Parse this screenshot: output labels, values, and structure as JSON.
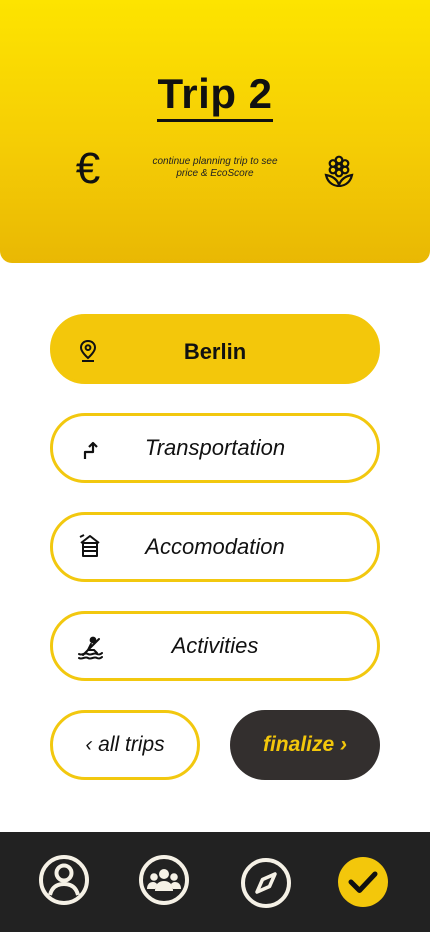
{
  "header": {
    "title": "Trip 2",
    "note": "continue planning trip to see price & EcoScore",
    "price_icon": "euro-icon",
    "eco_icon": "flower-icon"
  },
  "sections": [
    {
      "label": "Berlin",
      "icon": "location-pin-icon",
      "active": true
    },
    {
      "label": "Transportation",
      "icon": "route-arrow-icon",
      "active": false
    },
    {
      "label": "Accomodation",
      "icon": "house-icon",
      "active": false
    },
    {
      "label": "Activities",
      "icon": "kayak-icon",
      "active": false
    }
  ],
  "actions": {
    "all_trips": "‹ all trips",
    "finalize": "finalize ›"
  },
  "tabbar": {
    "items": [
      "profile-icon",
      "group-icon",
      "compass-icon",
      "check-icon"
    ],
    "active": "check-icon"
  },
  "colors": {
    "accent": "#f3c70b",
    "dark_button": "#332f2e",
    "tabbar": "#222222"
  }
}
